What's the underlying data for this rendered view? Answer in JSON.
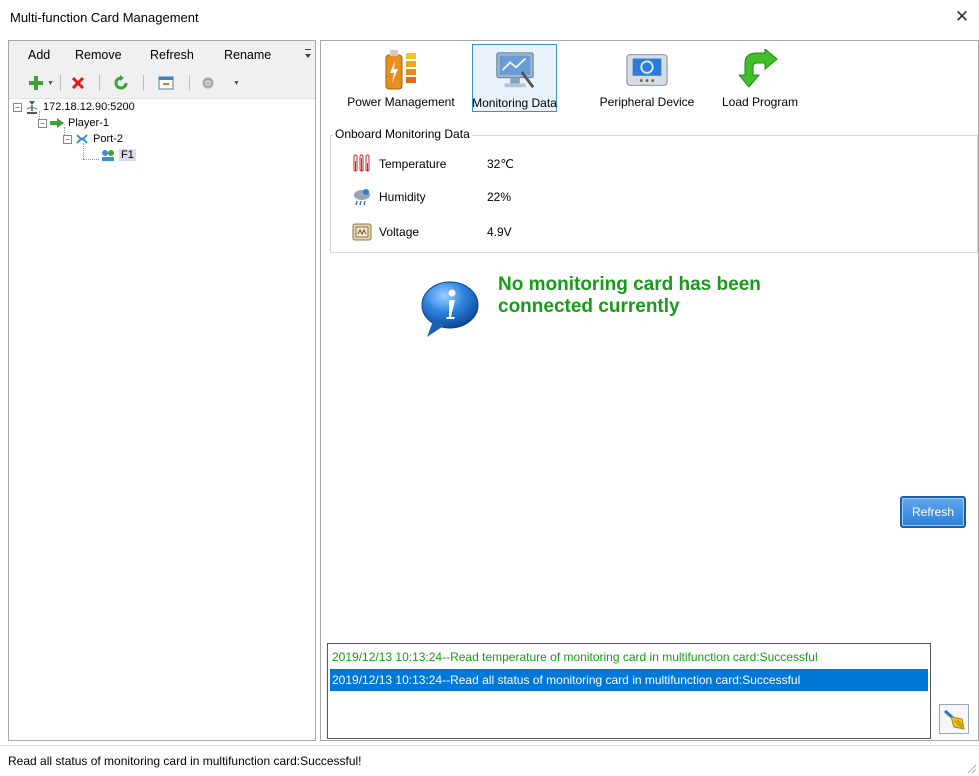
{
  "window": {
    "title": "Multi-function Card Management"
  },
  "menu": {
    "add": "Add",
    "remove": "Remove",
    "refresh": "Refresh",
    "rename": "Rename"
  },
  "tree": {
    "root": "172.18.12.90:5200",
    "player": "Player-1",
    "port": "Port-2",
    "card": "F1"
  },
  "func_tabs": [
    {
      "label": "Power Management",
      "icon": "battery-icon"
    },
    {
      "label": "Monitoring Data",
      "icon": "monitor-icon",
      "active": true
    },
    {
      "label": "Peripheral Device",
      "icon": "peripheral-device-icon"
    },
    {
      "label": "Load Program",
      "icon": "green-arrow-icon"
    }
  ],
  "monitoring": {
    "group_title": "Onboard Monitoring Data",
    "temperature_label": "Temperature",
    "temperature_value": "32℃",
    "humidity_label": "Humidity",
    "humidity_value": "22%",
    "voltage_label": "Voltage",
    "voltage_value": "4.9V"
  },
  "info_message": {
    "line1": "No monitoring card has been",
    "line2": "connected currently"
  },
  "refresh_button": "Refresh",
  "log": [
    "2019/12/13 10:13:24--Read temperature of monitoring card in multifunction card:Successful",
    "2019/12/13 10:13:24--Read all status of monitoring card in multifunction card:Successful"
  ],
  "status_bar": "Read all status of monitoring card in multifunction card:Successful!",
  "colors": {
    "accent_blue": "#0078d7",
    "success_green": "#1a9a1a",
    "refresh_button": "#2d7fd8"
  }
}
